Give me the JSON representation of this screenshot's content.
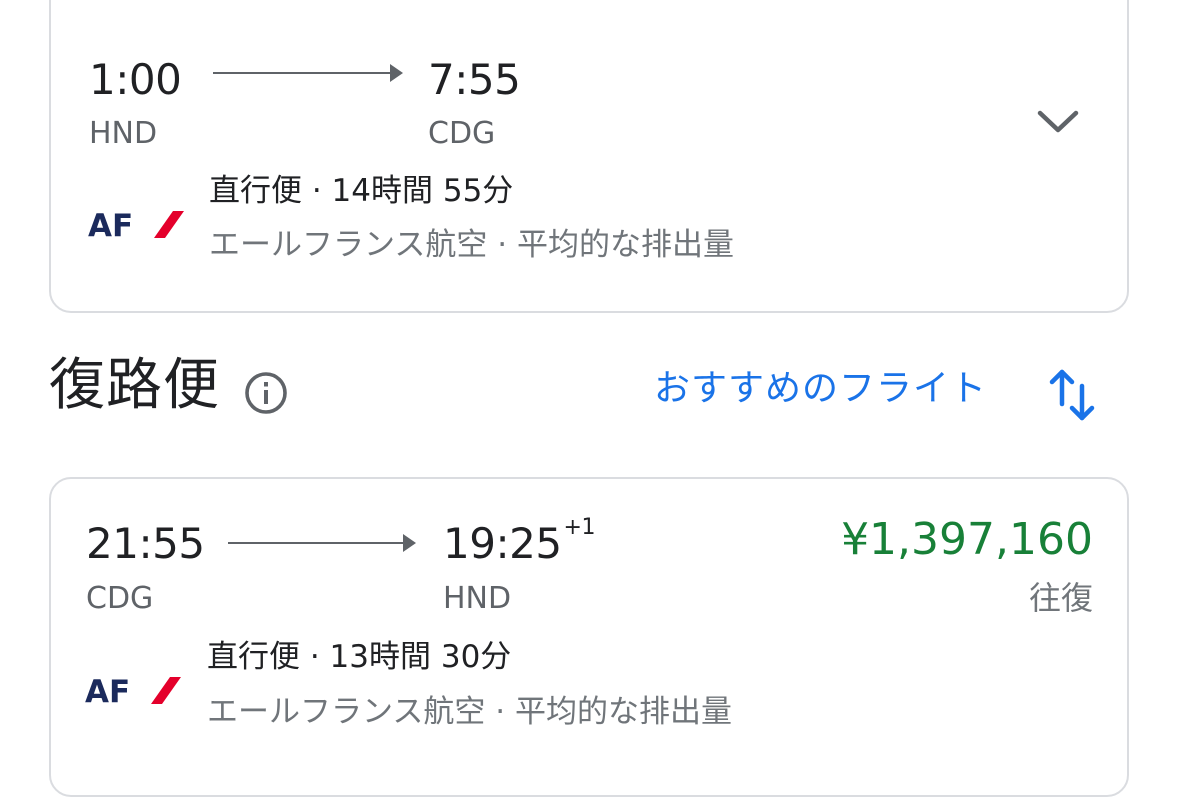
{
  "outbound": {
    "depart_time": "1:00",
    "depart_airport": "HND",
    "arrive_time": "7:55",
    "arrive_airport": "CDG",
    "stops_duration": "直行便 · 14時間 55分",
    "airline_emissions": "エールフランス航空 · 平均的な排出量",
    "airline_logo_text": "AF"
  },
  "return_section": {
    "title": "復路便",
    "sort_label": "おすすめのフライト"
  },
  "return_flight": {
    "depart_time": "21:55",
    "depart_airport": "CDG",
    "arrive_time": "19:25",
    "day_offset": "+1",
    "arrive_airport": "HND",
    "price": "¥1,397,160",
    "price_type": "往復",
    "stops_duration": "直行便 · 13時間 30分",
    "airline_emissions": "エールフランス航空 · 平均的な排出量",
    "airline_logo_text": "AF"
  },
  "colors": {
    "accent_blue": "#1a73e8",
    "price_green": "#188038",
    "af_navy": "#1b2a5c",
    "af_red": "#e4002b"
  },
  "icons": {
    "expand": "chevron-down-icon",
    "info": "info-icon",
    "sort": "swap-vertical-icon",
    "arrow": "arrow-right-icon",
    "logo": "air-france-logo"
  }
}
